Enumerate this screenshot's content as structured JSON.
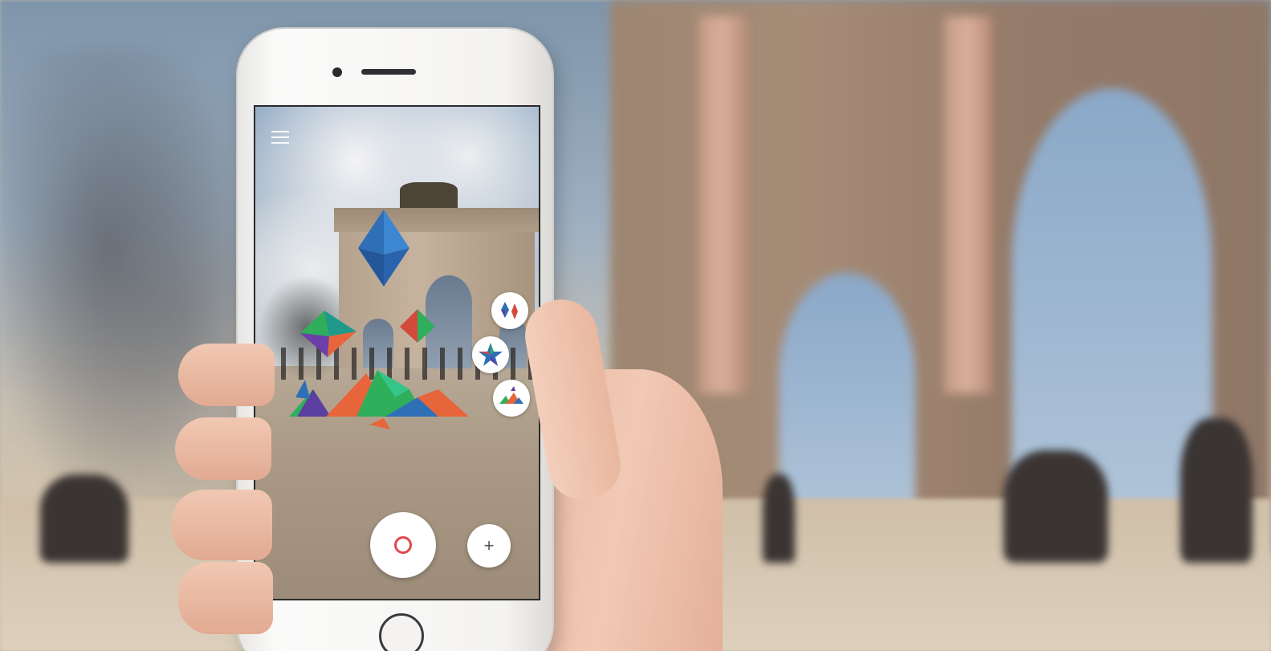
{
  "scene": {
    "description_hidden": "",
    "background_colors": {
      "sky": "#9fb0c1",
      "arch": "#a68c77",
      "ground": "#ddd0bd"
    }
  },
  "phone": {
    "color": "#f4f3f1",
    "ar_app": {
      "menu_icon": "hamburger-menu-icon",
      "shape_palette": [
        {
          "icon": "diamonds-icon"
        },
        {
          "icon": "star-icon"
        },
        {
          "icon": "mountains-icon"
        }
      ],
      "controls": {
        "record_icon": "record-icon",
        "add_icon": "plus-icon",
        "add_label": "+"
      },
      "colors": {
        "record": "#e2474c",
        "shape_blue": "#2f6fb8",
        "shape_green": "#2fae5b",
        "shape_orange": "#e8643a",
        "shape_purple": "#5b3fa0"
      }
    }
  }
}
